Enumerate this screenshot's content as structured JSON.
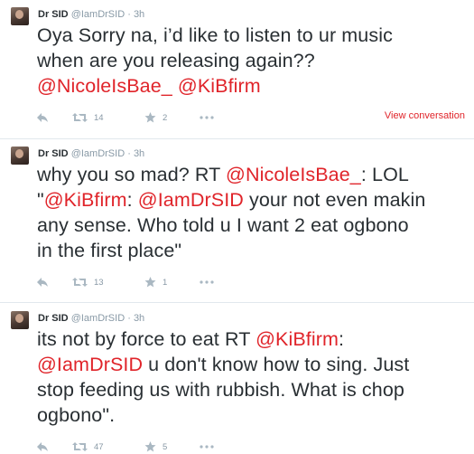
{
  "tweets": [
    {
      "author": "Dr SID",
      "handle": "@IamDrSID",
      "dot": "·",
      "time": "3h",
      "body_lines": [
        [
          {
            "t": "Oya Sorry na, i’d like to listen to ur music"
          }
        ],
        [
          {
            "t": "when are you releasing again??"
          }
        ],
        [
          {
            "t": "@NicoleIsBae_",
            "m": true
          },
          {
            "t": " "
          },
          {
            "t": "@KiBfirm",
            "m": true
          }
        ]
      ],
      "retweets": "14",
      "favorites": "2",
      "view_conversation": "View conversation"
    },
    {
      "author": "Dr SID",
      "handle": "@IamDrSID",
      "dot": "·",
      "time": "3h",
      "body_lines": [
        [
          {
            "t": "why you so mad? RT "
          },
          {
            "t": "@NicoleIsBae_",
            "m": true
          },
          {
            "t": ": LOL"
          }
        ],
        [
          {
            "t": "\""
          },
          {
            "t": "@KiBfirm",
            "m": true
          },
          {
            "t": ": "
          },
          {
            "t": "@IamDrSID",
            "m": true
          },
          {
            "t": " your not even makin"
          }
        ],
        [
          {
            "t": "any sense. Who told u I want 2 eat ogbono"
          }
        ],
        [
          {
            "t": "in the first place\""
          }
        ]
      ],
      "retweets": "13",
      "favorites": "1",
      "view_conversation": ""
    },
    {
      "author": "Dr SID",
      "handle": "@IamDrSID",
      "dot": "·",
      "time": "3h",
      "body_lines": [
        [
          {
            "t": "its not by force to eat RT "
          },
          {
            "t": "@KiBfirm",
            "m": true
          },
          {
            "t": ":"
          }
        ],
        [
          {
            "t": "@IamDrSID",
            "m": true
          },
          {
            "t": " u don't know how to sing. Just"
          }
        ],
        [
          {
            "t": "stop feeding us with rubbish. What is chop"
          }
        ],
        [
          {
            "t": "ogbono\"."
          }
        ]
      ],
      "retweets": "47",
      "favorites": "5",
      "view_conversation": ""
    }
  ],
  "colors": {
    "mention": "#e0242a",
    "meta": "#8899a6",
    "text": "#292f33",
    "divider": "#e1e8ed"
  },
  "icons": [
    "reply-icon",
    "retweet-icon",
    "favorite-icon",
    "more-icon"
  ]
}
